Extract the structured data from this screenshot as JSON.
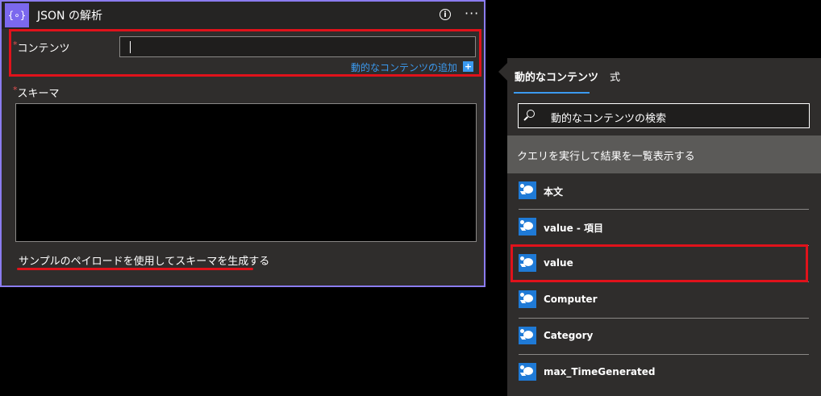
{
  "card": {
    "icon_glyph": "{∘}",
    "title": "JSON の解析",
    "info_glyph": "i",
    "more_glyph": "···",
    "content_label": "コンテンツ",
    "required_mark": "*",
    "add_dynamic_label": "動的なコンテンツの追加",
    "add_plus_glyph": "+",
    "schema_label": "スキーマ",
    "generate_link": "サンプルのペイロードを使用してスキーマを生成する"
  },
  "flyout": {
    "tabs": [
      "動的なコンテンツ",
      "式"
    ],
    "search_placeholder": "動的なコンテンツの検索",
    "section_title": "クエリを実行して結果を一覧表示する",
    "items": [
      "本文",
      "value - 項目",
      "value",
      "Computer",
      "Category",
      "max_TimeGenerated"
    ]
  },
  "colors": {
    "accent": "#3b9af0",
    "card_border": "#8b7cf0",
    "highlight": "#e0121b"
  }
}
